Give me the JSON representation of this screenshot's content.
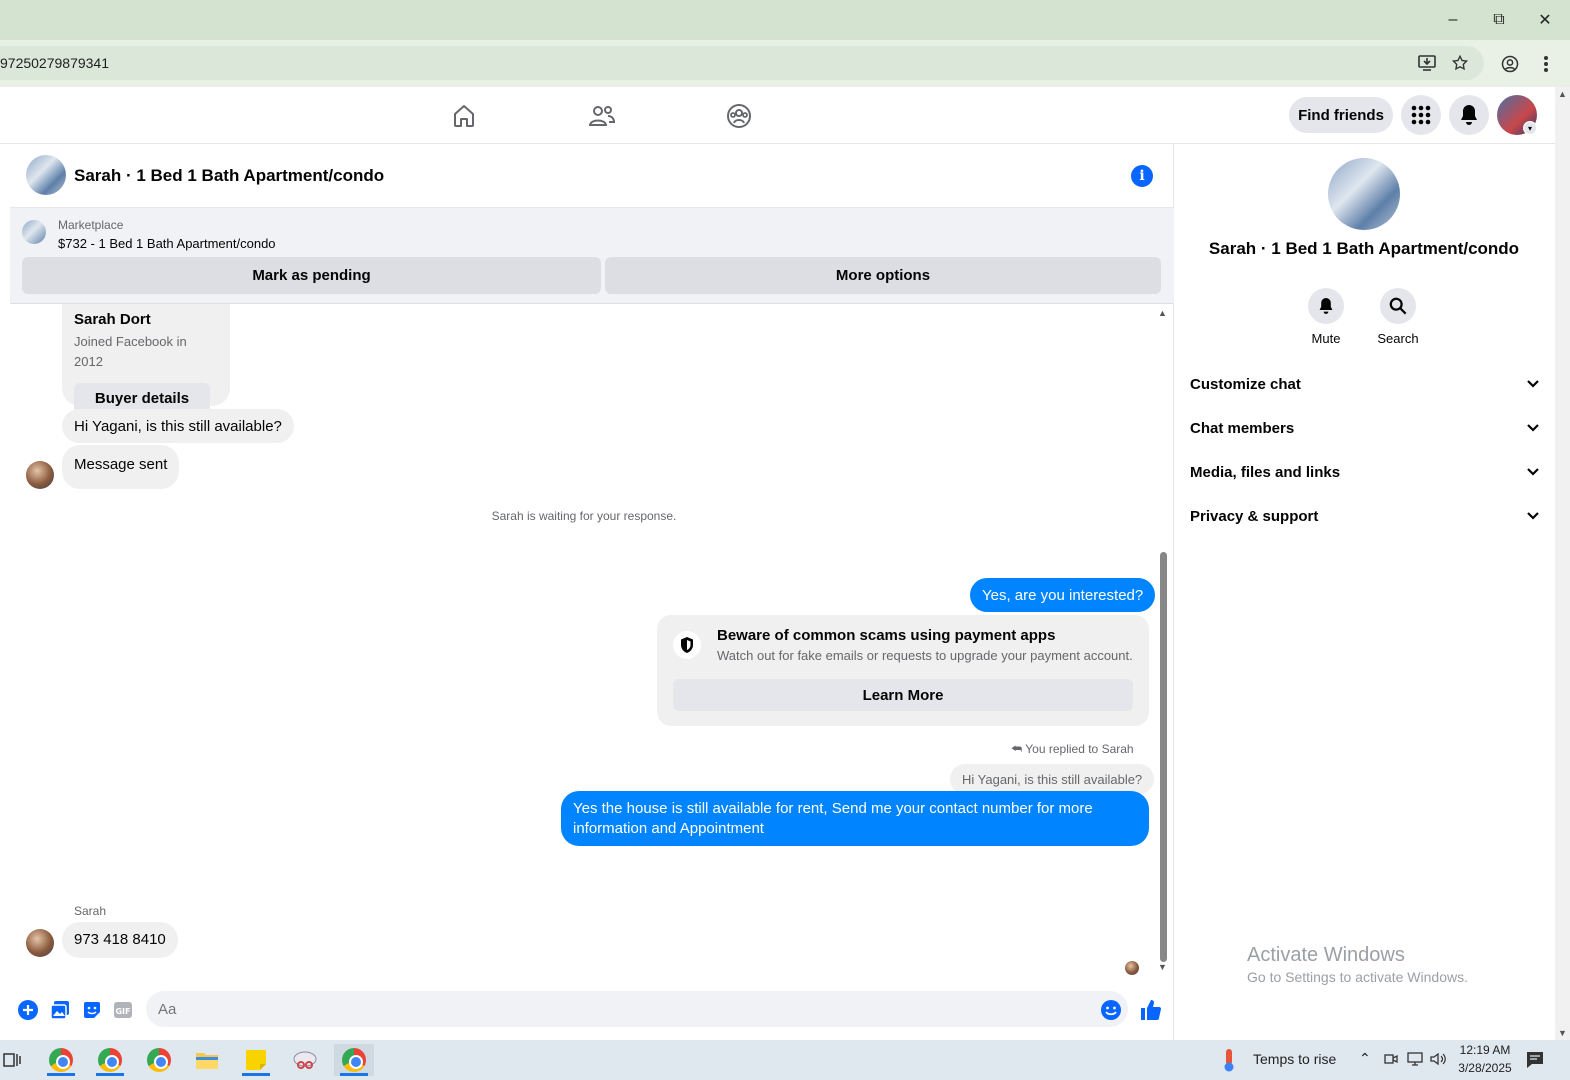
{
  "browser": {
    "url": "97250279879341"
  },
  "nav": {
    "find_friends": "Find friends"
  },
  "chat": {
    "title": "Sarah · 1 Bed 1 Bath Apartment/condo",
    "marketplace_label": "Marketplace",
    "listing": "$732 - 1 Bed 1 Bath Apartment/condo",
    "mark_pending": "Mark as pending",
    "more_options": "More options",
    "buyer_name": "Sarah Dort",
    "buyer_joined": "Joined Facebook in 2012",
    "buyer_details": "Buyer details",
    "msg1": "Hi Yagani, is this still available?",
    "msg2": "Message sent",
    "waiting": "Sarah is waiting for your response.",
    "out1": "Yes, are you interested?",
    "scam_title": "Beware of common scams using payment apps",
    "scam_body": "Watch out for fake emails or requests to upgrade your payment account.",
    "learn_more": "Learn More",
    "replied_to": "You replied to Sarah",
    "quoted": "Hi Yagani, is this still available?",
    "out2": "Yes the house is still available for rent, Send me your contact number for more information and Appointment",
    "sender_name": "Sarah",
    "msg3": "973 418 8410",
    "input_placeholder": "Aa"
  },
  "panel": {
    "title": "Sarah · 1 Bed 1 Bath Apartment/condo",
    "mute": "Mute",
    "search": "Search",
    "rows": [
      "Customize chat",
      "Chat members",
      "Media, files and links",
      "Privacy & support"
    ]
  },
  "watermark": {
    "line1": "Activate Windows",
    "line2": "Go to Settings to activate Windows."
  },
  "taskbar": {
    "weather": "Temps to rise",
    "time": "12:19 AM",
    "date": "3/28/2025"
  },
  "colors": {
    "accent": "#0866ff",
    "outgoing_bubble": "#0084ff",
    "incoming_bubble": "#f0f0f0"
  }
}
